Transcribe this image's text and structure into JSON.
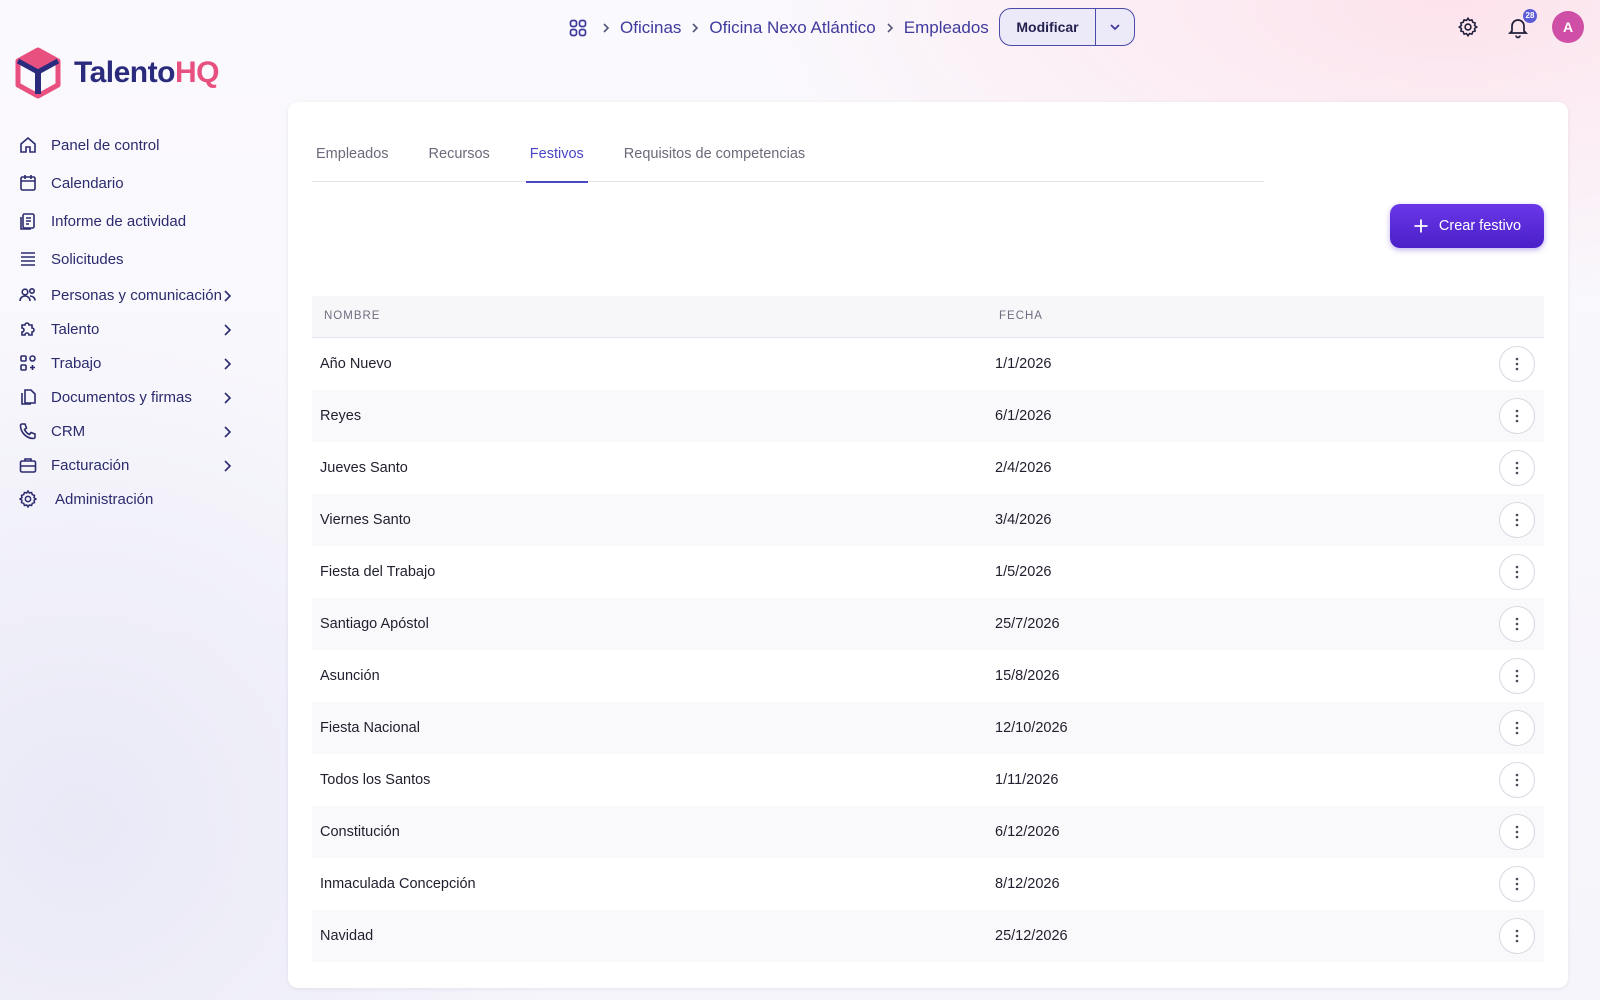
{
  "breadcrumb": {
    "items": [
      "Oficinas",
      "Oficina Nexo Atlántico",
      "Empleados"
    ]
  },
  "toolbar": {
    "modify_label": "Modificar"
  },
  "header": {
    "notifications_count": "28",
    "avatar_initial": "A"
  },
  "brand": {
    "name_part1": "Talento",
    "name_part2": "HQ",
    "colors": {
      "primary": "#2b2b7e",
      "accent": "#e8517f"
    }
  },
  "sidebar": {
    "items": [
      {
        "label": "Panel de control",
        "icon": "home-icon"
      },
      {
        "label": "Calendario",
        "icon": "calendar-icon"
      },
      {
        "label": "Informe de actividad",
        "icon": "report-icon"
      },
      {
        "label": "Solicitudes",
        "icon": "list-icon"
      },
      {
        "label": "Personas y comunicación",
        "icon": "people-icon",
        "has_submenu": true
      },
      {
        "label": "Talento",
        "icon": "puzzle-icon",
        "has_submenu": true
      },
      {
        "label": "Trabajo",
        "icon": "apps-icon",
        "has_submenu": true
      },
      {
        "label": "Documentos y firmas",
        "icon": "documents-icon",
        "has_submenu": true
      },
      {
        "label": "CRM",
        "icon": "phone-icon",
        "has_submenu": true
      },
      {
        "label": "Facturación",
        "icon": "briefcase-icon",
        "has_submenu": true
      },
      {
        "label": "Administración",
        "icon": "gear-icon"
      }
    ]
  },
  "main": {
    "tabs": [
      {
        "label": "Empleados",
        "active": false
      },
      {
        "label": "Recursos",
        "active": false
      },
      {
        "label": "Festivos",
        "active": true
      },
      {
        "label": "Requisitos de competencias",
        "active": false
      }
    ],
    "create_button_label": "Crear festivo",
    "table": {
      "columns": [
        "NOMBRE",
        "FECHA"
      ],
      "rows": [
        {
          "name": "Año Nuevo",
          "date": "1/1/2026"
        },
        {
          "name": "Reyes",
          "date": "6/1/2026"
        },
        {
          "name": "Jueves Santo",
          "date": "2/4/2026"
        },
        {
          "name": "Viernes Santo",
          "date": "3/4/2026"
        },
        {
          "name": "Fiesta del Trabajo",
          "date": "1/5/2026"
        },
        {
          "name": "Santiago Apóstol",
          "date": "25/7/2026"
        },
        {
          "name": "Asunción",
          "date": "15/8/2026"
        },
        {
          "name": "Fiesta Nacional",
          "date": "12/10/2026"
        },
        {
          "name": "Todos los Santos",
          "date": "1/11/2026"
        },
        {
          "name": "Constitución",
          "date": "6/12/2026"
        },
        {
          "name": "Inmaculada Concepción",
          "date": "8/12/2026"
        },
        {
          "name": "Navidad",
          "date": "25/12/2026"
        }
      ]
    }
  }
}
